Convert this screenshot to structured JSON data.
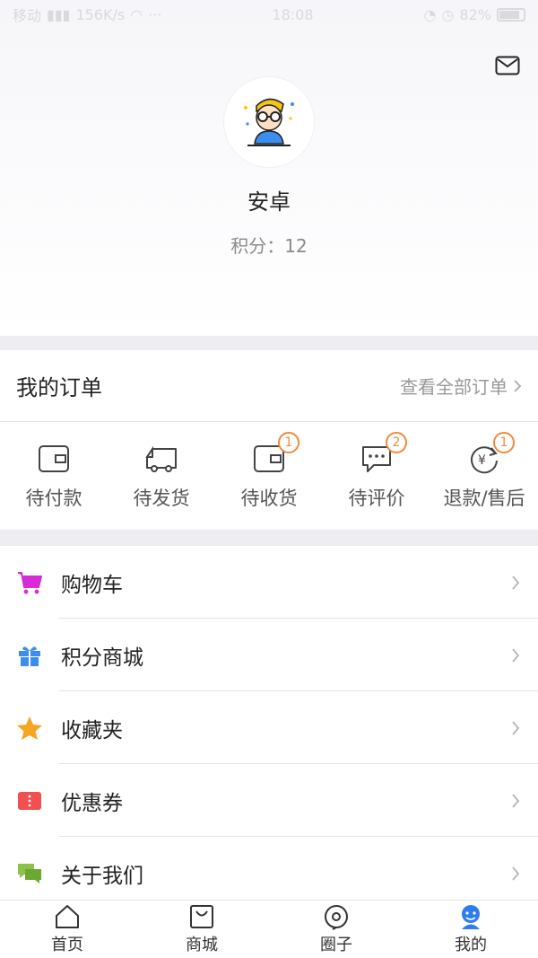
{
  "status": {
    "carrier": "移动",
    "speed": "156K/s",
    "time": "18:08",
    "battery": "82%"
  },
  "profile": {
    "name": "安卓",
    "points_label": "积分：12"
  },
  "orders": {
    "title": "我的订单",
    "view_all": "查看全部订单",
    "items": [
      {
        "label": "待付款",
        "icon": "wallet-icon"
      },
      {
        "label": "待发货",
        "icon": "truck-icon"
      },
      {
        "label": "待收货",
        "icon": "wallet-icon",
        "badge": "1"
      },
      {
        "label": "待评价",
        "icon": "comment-icon",
        "badge": "2"
      },
      {
        "label": "退款/售后",
        "icon": "refund-icon",
        "badge": "1"
      }
    ]
  },
  "menu": [
    {
      "label": "购物车",
      "icon": "cart-icon",
      "color": "#d62bd6"
    },
    {
      "label": "积分商城",
      "icon": "gift-icon",
      "color": "#3a8ef0"
    },
    {
      "label": "收藏夹",
      "icon": "star-icon",
      "color": "#f5a623"
    },
    {
      "label": "优惠券",
      "icon": "coupon-icon",
      "color": "#f05050"
    },
    {
      "label": "关于我们",
      "icon": "chat-icon",
      "color": "#8bc34a"
    }
  ],
  "tabbar": [
    {
      "label": "首页",
      "icon": "home-icon"
    },
    {
      "label": "商城",
      "icon": "bag-icon"
    },
    {
      "label": "圈子",
      "icon": "circle-icon"
    },
    {
      "label": "我的",
      "icon": "user-icon",
      "active": true
    }
  ],
  "colors": {
    "badge": "#f08a3c",
    "active_tab": "#2f7cf0"
  }
}
